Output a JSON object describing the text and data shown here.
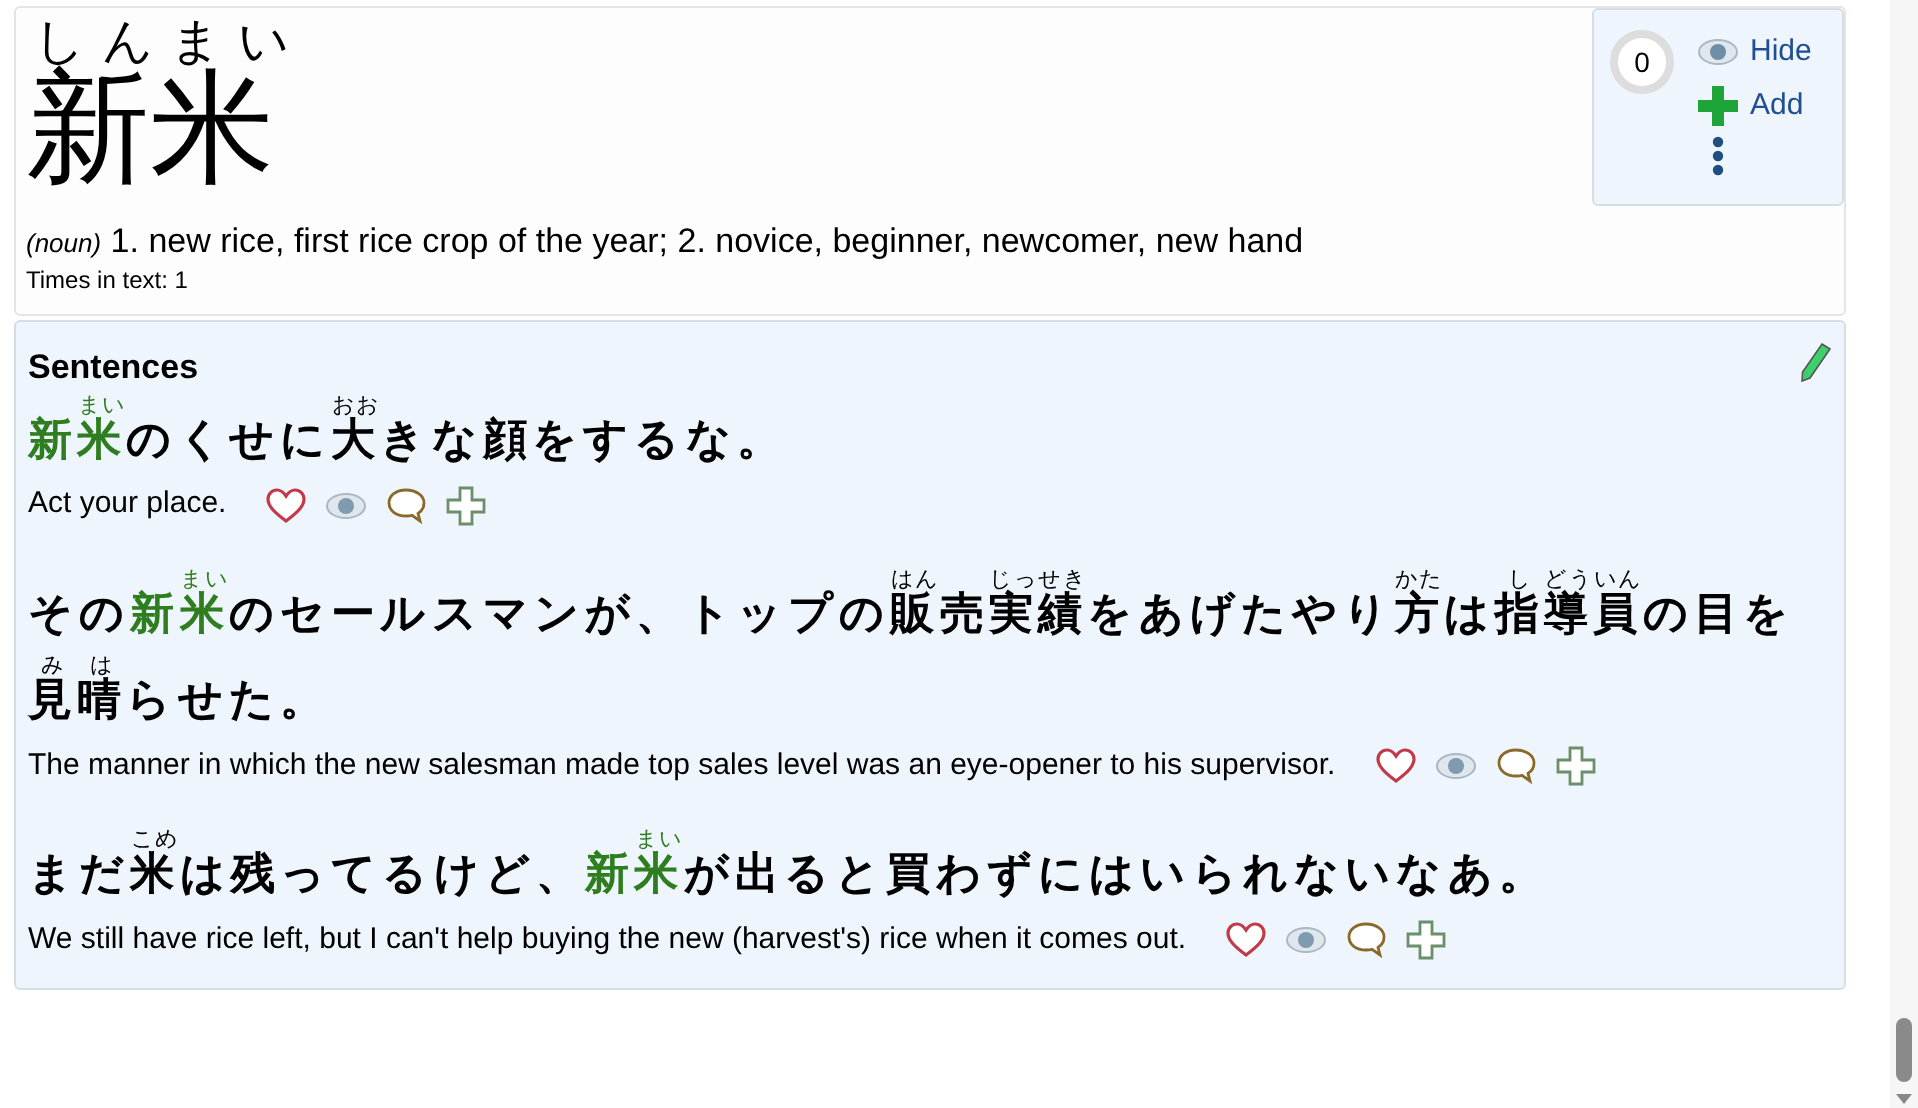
{
  "entry": {
    "reading": "しんまい",
    "word": "新米",
    "part_of_speech": "(noun)",
    "definition": "1. new rice, first rice crop of the year; 2. novice, beginner, newcomer, new hand",
    "times_in_text": "Times in text: 1"
  },
  "side_panel": {
    "counter": "0",
    "hide_label": "Hide",
    "add_label": "Add"
  },
  "sentences": {
    "title": "Sentences",
    "items": [
      {
        "segments": [
          {
            "text": "新",
            "kind": "keyword"
          },
          {
            "text": "米",
            "reading": "まい",
            "kind": "keyword"
          },
          {
            "text": "のくせに",
            "kind": "text"
          },
          {
            "text": "大",
            "reading": "おお",
            "kind": "text"
          },
          {
            "text": "きな顔をするな。",
            "kind": "text"
          }
        ],
        "translation": "Act your place."
      },
      {
        "segments": [
          {
            "text": "その",
            "kind": "text"
          },
          {
            "text": "新",
            "kind": "keyword"
          },
          {
            "text": "米",
            "reading": "まい",
            "kind": "keyword"
          },
          {
            "text": "のセールスマンが、トップの",
            "kind": "text"
          },
          {
            "text": "販",
            "reading": "はん",
            "kind": "text"
          },
          {
            "text": "売",
            "kind": "text"
          },
          {
            "text": "実績",
            "reading": "じっせき",
            "kind": "text"
          },
          {
            "text": "をあげたやり",
            "kind": "text"
          },
          {
            "text": "方",
            "reading": "かた",
            "kind": "text"
          },
          {
            "text": "は",
            "kind": "text"
          },
          {
            "text": "指",
            "reading": "し",
            "kind": "text"
          },
          {
            "text": "導員",
            "reading": "どういん",
            "kind": "text"
          },
          {
            "text": "の目を",
            "kind": "text"
          },
          {
            "text": "見",
            "reading": "み",
            "kind": "text"
          },
          {
            "text": "晴",
            "reading": "は",
            "kind": "text"
          },
          {
            "text": "らせた。",
            "kind": "text"
          }
        ],
        "translation": "The manner in which the new salesman made top sales level was an eye-opener to his supervisor."
      },
      {
        "segments": [
          {
            "text": "まだ",
            "kind": "text"
          },
          {
            "text": "米",
            "reading": "こめ",
            "kind": "text"
          },
          {
            "text": "は残ってるけど、",
            "kind": "text"
          },
          {
            "text": "新",
            "kind": "keyword"
          },
          {
            "text": "米",
            "reading": "まい",
            "kind": "keyword"
          },
          {
            "text": "が出ると買わずにはいられないなあ。",
            "kind": "text"
          }
        ],
        "translation": "We still have rice left, but I can't help buying the new (harvest's) rice when it comes out."
      }
    ]
  }
}
